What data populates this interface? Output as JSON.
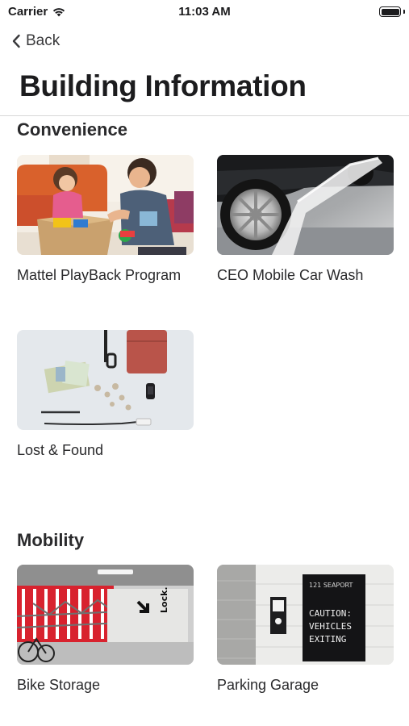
{
  "status_bar": {
    "carrier": "Carrier",
    "time": "11:03 AM"
  },
  "nav": {
    "back_label": "Back"
  },
  "page": {
    "title": "Building Information"
  },
  "sections": [
    {
      "title": "Convenience",
      "items": [
        {
          "label": "Mattel PlayBack Program"
        },
        {
          "label": "CEO Mobile Car Wash"
        },
        {
          "label": "Lost & Found"
        }
      ]
    },
    {
      "title": "Mobility",
      "items": [
        {
          "label": "Bike Storage",
          "sign_text": "Lock."
        },
        {
          "label": "Parking Garage",
          "sign_brand": "121 SEAPORT",
          "sign_lines": [
            "CAUTION:",
            "VEHICLES",
            "EXITING"
          ]
        }
      ]
    }
  ]
}
